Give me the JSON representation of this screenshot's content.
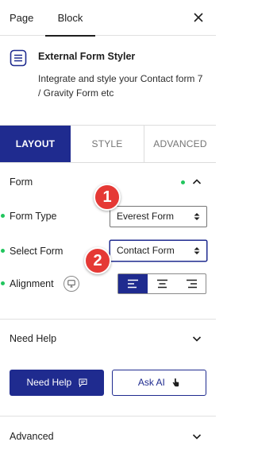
{
  "top_tabs": {
    "page": "Page",
    "block": "Block"
  },
  "block": {
    "title": "External Form Styler",
    "description": "Integrate and style your Contact form 7 / Gravity Form etc",
    "icon": "form-list-icon"
  },
  "settings_tabs": {
    "layout": "LAYOUT",
    "style": "STYLE",
    "advanced": "ADVANCED",
    "active": "LAYOUT"
  },
  "form_panel": {
    "title": "Form",
    "form_type_label": "Form Type",
    "form_type_value": "Everest Form",
    "select_form_label": "Select Form",
    "select_form_value": "Contact Form",
    "alignment_label": "Alignment",
    "alignment_selected": "left"
  },
  "annotations": {
    "badge_1": "1",
    "badge_2": "2"
  },
  "need_help": {
    "title": "Need Help",
    "primary_button": "Need Help",
    "secondary_button": "Ask AI"
  },
  "advanced_section": {
    "title": "Advanced"
  },
  "colors": {
    "accent": "#1f2b8f",
    "dot": "#22c55e",
    "badge": "#e53935"
  }
}
